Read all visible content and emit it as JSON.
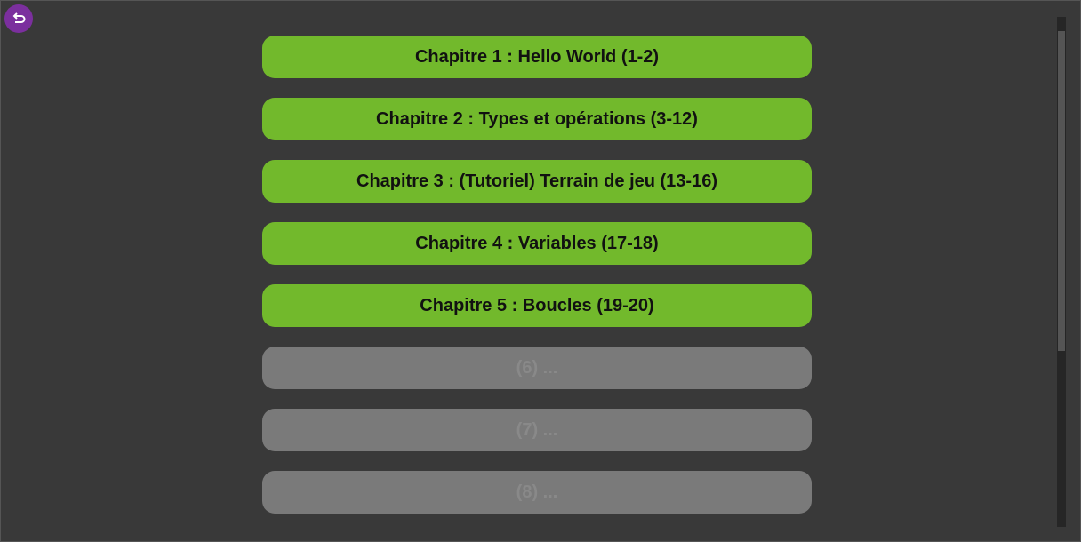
{
  "back_button": {
    "icon": "return-arrow-icon",
    "color": "#7b2f9e"
  },
  "chapters": [
    {
      "label": "Chapitre 1 : Hello World (1-2)",
      "status": "unlocked"
    },
    {
      "label": "Chapitre 2 : Types et opérations (3-12)",
      "status": "unlocked"
    },
    {
      "label": "Chapitre 3 : (Tutoriel) Terrain de jeu (13-16)",
      "status": "unlocked"
    },
    {
      "label": "Chapitre 4 : Variables (17-18)",
      "status": "unlocked"
    },
    {
      "label": "Chapitre 5 : Boucles (19-20)",
      "status": "unlocked"
    },
    {
      "label": "(6) ...",
      "status": "locked"
    },
    {
      "label": "(7) ...",
      "status": "locked"
    },
    {
      "label": "(8) ...",
      "status": "locked"
    }
  ],
  "colors": {
    "background": "#393939",
    "unlocked": "#72b92c",
    "locked": "#7a7a7a",
    "accent": "#7b2f9e"
  }
}
